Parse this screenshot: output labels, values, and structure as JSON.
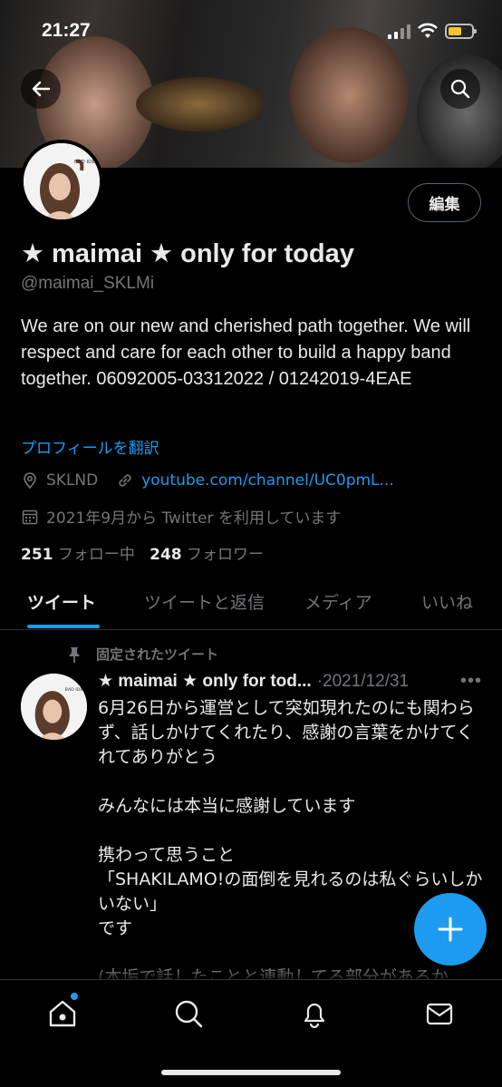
{
  "status_bar": {
    "time": "21:27"
  },
  "profile": {
    "name": "★ maimai ★ only for today",
    "handle": "@maimai_SKLMi",
    "edit_label": "編集",
    "bio": "We are on our new and cherished path together. We will respect and care for each other to build a happy band together. 06092005-03312022 / 01242019-4EAE",
    "translate_label": "プロフィールを翻訳",
    "location": "SKLND",
    "link": "youtube.com/channel/UC0pmL...",
    "joined": "2021年9月から Twitter を利用しています",
    "following_count": "251",
    "following_label": "フォロー中",
    "followers_count": "248",
    "followers_label": "フォロワー",
    "avatar_text": "BAD IDEA"
  },
  "tabs": [
    {
      "label": "ツイート",
      "active": true
    },
    {
      "label": "ツイートと返信",
      "active": false
    },
    {
      "label": "メディア",
      "active": false
    },
    {
      "label": "いいね",
      "active": false
    }
  ],
  "pinned_tweet": {
    "pinned_label": "固定されたツイート",
    "author": "★ maimai ★ only for tod...",
    "date": "2021/12/31",
    "body": "6月26日から運営として突如現れたのにも関わらず、話しかけてくれたり、感謝の言葉をかけてくれてありがとう\n\nみんなには本当に感謝しています\n\n携わって思うこと\n「SHAKILAMO!の面倒を見れるのは私ぐらいしかいない」\nです\n\n(本垢で話したことと連動してる部分があるか"
  },
  "colors": {
    "accent": "#1d9bf0",
    "background": "#000000",
    "secondary_text": "#71767b"
  },
  "icons": [
    "back-arrow-icon",
    "search-icon",
    "location-icon",
    "link-icon",
    "calendar-icon",
    "pin-icon",
    "more-icon",
    "compose-plus-icon",
    "home-icon",
    "explore-search-icon",
    "bell-icon",
    "mail-icon"
  ]
}
